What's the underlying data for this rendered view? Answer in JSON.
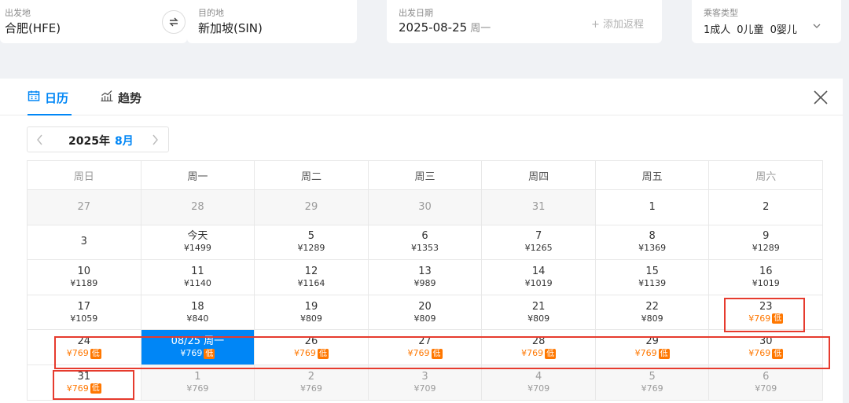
{
  "search": {
    "origin": {
      "label": "出发地",
      "value": "合肥(HFE)"
    },
    "destination": {
      "label": "目的地",
      "value": "新加坡(SIN)"
    },
    "depart": {
      "label": "出发日期",
      "value": "2025-08-25",
      "weekday": "周一",
      "add_return": "+ 添加返程"
    },
    "passengers": {
      "label": "乘客类型",
      "adult": "1成人",
      "child": "0儿童",
      "infant": "0婴儿"
    }
  },
  "tabs": {
    "calendar": "日历",
    "trend": "趋势"
  },
  "month_nav": {
    "year": "2025年",
    "month": "8月"
  },
  "weekdays": [
    "周日",
    "周一",
    "周二",
    "周三",
    "周四",
    "周五",
    "周六"
  ],
  "weeks": [
    [
      {
        "day": "27",
        "price": "",
        "out": true
      },
      {
        "day": "28",
        "price": "",
        "out": true
      },
      {
        "day": "29",
        "price": "",
        "out": true
      },
      {
        "day": "30",
        "price": "",
        "out": true
      },
      {
        "day": "31",
        "price": "",
        "out": true
      },
      {
        "day": "1",
        "price": ""
      },
      {
        "day": "2",
        "price": ""
      }
    ],
    [
      {
        "day": "3",
        "price": ""
      },
      {
        "day": "今天",
        "price": "¥1499"
      },
      {
        "day": "5",
        "price": "¥1289"
      },
      {
        "day": "6",
        "price": "¥1353"
      },
      {
        "day": "7",
        "price": "¥1265"
      },
      {
        "day": "8",
        "price": "¥1369"
      },
      {
        "day": "9",
        "price": "¥1289"
      }
    ],
    [
      {
        "day": "10",
        "price": "¥1189"
      },
      {
        "day": "11",
        "price": "¥1140"
      },
      {
        "day": "12",
        "price": "¥1164"
      },
      {
        "day": "13",
        "price": "¥989"
      },
      {
        "day": "14",
        "price": "¥1019"
      },
      {
        "day": "15",
        "price": "¥1139"
      },
      {
        "day": "16",
        "price": "¥1019"
      }
    ],
    [
      {
        "day": "17",
        "price": "¥1059"
      },
      {
        "day": "18",
        "price": "¥840"
      },
      {
        "day": "19",
        "price": "¥809"
      },
      {
        "day": "20",
        "price": "¥809"
      },
      {
        "day": "21",
        "price": "¥809"
      },
      {
        "day": "22",
        "price": "¥809"
      },
      {
        "day": "23",
        "price": "¥769",
        "low": true
      }
    ],
    [
      {
        "day": "24",
        "price": "¥769",
        "low": true
      },
      {
        "day": "08/25 周一",
        "price": "¥769",
        "low": true,
        "selected": true
      },
      {
        "day": "26",
        "price": "¥769",
        "low": true
      },
      {
        "day": "27",
        "price": "¥769",
        "low": true
      },
      {
        "day": "28",
        "price": "¥769",
        "low": true
      },
      {
        "day": "29",
        "price": "¥769",
        "low": true
      },
      {
        "day": "30",
        "price": "¥769",
        "low": true
      }
    ],
    [
      {
        "day": "31",
        "price": "¥769",
        "low": true
      },
      {
        "day": "1",
        "price": "¥769",
        "out": true
      },
      {
        "day": "2",
        "price": "¥769",
        "out": true
      },
      {
        "day": "3",
        "price": "¥709",
        "out": true
      },
      {
        "day": "4",
        "price": "¥709",
        "out": true
      },
      {
        "day": "5",
        "price": "¥769",
        "out": true
      },
      {
        "day": "6",
        "price": "¥709",
        "out": true
      }
    ]
  ],
  "low_tag": "低",
  "colors": {
    "accent": "#0086f6",
    "low_price": "#ff7700",
    "highlight_box": "#e63b2e"
  }
}
